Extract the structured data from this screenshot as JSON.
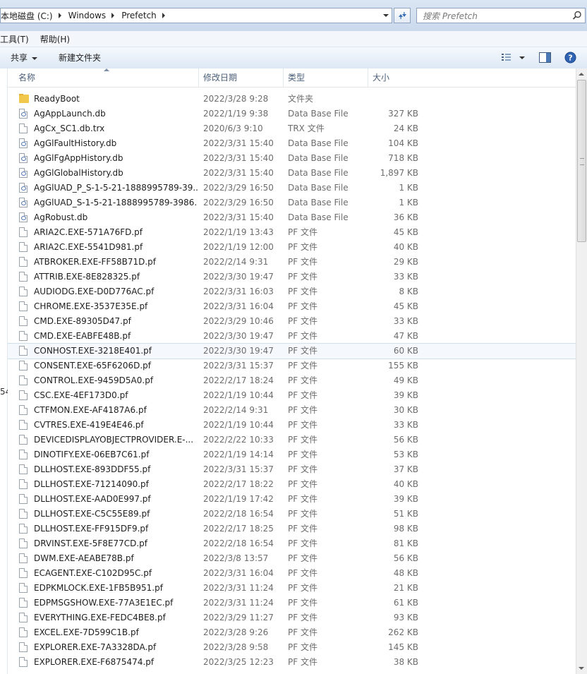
{
  "address": {
    "crumbs": [
      "本地磁盘 (C:)",
      "Windows",
      "Prefetch"
    ]
  },
  "search": {
    "placeholder": "搜索 Prefetch"
  },
  "menu": {
    "items": [
      "工具(T)",
      "帮助(H)"
    ]
  },
  "toolbar": {
    "share_label": "共享",
    "new_folder_label": "新建文件夹"
  },
  "columns": {
    "name": "名称",
    "date": "修改日期",
    "type": "类型",
    "size": "大小"
  },
  "selected_row": 17,
  "stray_glyph": "54",
  "files": [
    {
      "icon": "folder",
      "name": "ReadyBoot",
      "date": "2022/3/28 9:28",
      "type": "文件夹",
      "size": ""
    },
    {
      "icon": "db",
      "name": "AgAppLaunch.db",
      "date": "2022/1/19 9:38",
      "type": "Data Base File",
      "size": "327 KB"
    },
    {
      "icon": "file",
      "name": "AgCx_SC1.db.trx",
      "date": "2020/6/3 9:10",
      "type": "TRX 文件",
      "size": "24 KB"
    },
    {
      "icon": "db",
      "name": "AgGlFaultHistory.db",
      "date": "2022/3/31 15:40",
      "type": "Data Base File",
      "size": "104 KB"
    },
    {
      "icon": "db",
      "name": "AgGlFgAppHistory.db",
      "date": "2022/3/31 15:40",
      "type": "Data Base File",
      "size": "718 KB"
    },
    {
      "icon": "db",
      "name": "AgGlGlobalHistory.db",
      "date": "2022/3/31 15:40",
      "type": "Data Base File",
      "size": "1,897 KB"
    },
    {
      "icon": "db",
      "name": "AgGlUAD_P_S-1-5-21-1888995789-39...",
      "date": "2022/3/29 16:50",
      "type": "Data Base File",
      "size": "1 KB"
    },
    {
      "icon": "db",
      "name": "AgGlUAD_S-1-5-21-1888995789-3986...",
      "date": "2022/3/29 16:50",
      "type": "Data Base File",
      "size": "1 KB"
    },
    {
      "icon": "db",
      "name": "AgRobust.db",
      "date": "2022/3/31 15:40",
      "type": "Data Base File",
      "size": "36 KB"
    },
    {
      "icon": "file",
      "name": "ARIA2C.EXE-571A76FD.pf",
      "date": "2022/1/19 13:43",
      "type": "PF 文件",
      "size": "45 KB"
    },
    {
      "icon": "file",
      "name": "ARIA2C.EXE-5541D981.pf",
      "date": "2022/1/19 12:00",
      "type": "PF 文件",
      "size": "40 KB"
    },
    {
      "icon": "file",
      "name": "ATBROKER.EXE-FF58B71D.pf",
      "date": "2022/2/14 9:31",
      "type": "PF 文件",
      "size": "29 KB"
    },
    {
      "icon": "file",
      "name": "ATTRIB.EXE-8E828325.pf",
      "date": "2022/3/30 19:47",
      "type": "PF 文件",
      "size": "33 KB"
    },
    {
      "icon": "file",
      "name": "AUDIODG.EXE-D0D776AC.pf",
      "date": "2022/3/31 16:03",
      "type": "PF 文件",
      "size": "8 KB"
    },
    {
      "icon": "file",
      "name": "CHROME.EXE-3537E35E.pf",
      "date": "2022/3/31 16:04",
      "type": "PF 文件",
      "size": "45 KB"
    },
    {
      "icon": "file",
      "name": "CMD.EXE-89305D47.pf",
      "date": "2022/3/29 10:46",
      "type": "PF 文件",
      "size": "33 KB"
    },
    {
      "icon": "file",
      "name": "CMD.EXE-EABFE48B.pf",
      "date": "2022/3/30 19:47",
      "type": "PF 文件",
      "size": "47 KB"
    },
    {
      "icon": "file",
      "name": "CONHOST.EXE-3218E401.pf",
      "date": "2022/3/30 19:47",
      "type": "PF 文件",
      "size": "60 KB"
    },
    {
      "icon": "file",
      "name": "CONSENT.EXE-65F6206D.pf",
      "date": "2022/3/31 15:37",
      "type": "PF 文件",
      "size": "155 KB"
    },
    {
      "icon": "file",
      "name": "CONTROL.EXE-9459D5A0.pf",
      "date": "2022/2/17 18:24",
      "type": "PF 文件",
      "size": "49 KB"
    },
    {
      "icon": "file",
      "name": "CSC.EXE-4EF173D0.pf",
      "date": "2022/1/19 10:44",
      "type": "PF 文件",
      "size": "39 KB"
    },
    {
      "icon": "file",
      "name": "CTFMON.EXE-AF4187A6.pf",
      "date": "2022/2/14 9:31",
      "type": "PF 文件",
      "size": "30 KB"
    },
    {
      "icon": "file",
      "name": "CVTRES.EXE-419E4E46.pf",
      "date": "2022/1/19 10:44",
      "type": "PF 文件",
      "size": "33 KB"
    },
    {
      "icon": "file",
      "name": "DEVICEDISPLAYOBJECTPROVIDER.E-...",
      "date": "2022/2/22 10:33",
      "type": "PF 文件",
      "size": "56 KB"
    },
    {
      "icon": "file",
      "name": "DINOTIFY.EXE-06EB7C61.pf",
      "date": "2022/1/19 14:14",
      "type": "PF 文件",
      "size": "53 KB"
    },
    {
      "icon": "file",
      "name": "DLLHOST.EXE-893DDF55.pf",
      "date": "2022/3/31 15:37",
      "type": "PF 文件",
      "size": "37 KB"
    },
    {
      "icon": "file",
      "name": "DLLHOST.EXE-71214090.pf",
      "date": "2022/2/17 18:22",
      "type": "PF 文件",
      "size": "40 KB"
    },
    {
      "icon": "file",
      "name": "DLLHOST.EXE-AAD0E997.pf",
      "date": "2022/1/19 17:42",
      "type": "PF 文件",
      "size": "39 KB"
    },
    {
      "icon": "file",
      "name": "DLLHOST.EXE-C5C55E89.pf",
      "date": "2022/2/18 16:54",
      "type": "PF 文件",
      "size": "51 KB"
    },
    {
      "icon": "file",
      "name": "DLLHOST.EXE-FF915DF9.pf",
      "date": "2022/2/17 18:25",
      "type": "PF 文件",
      "size": "98 KB"
    },
    {
      "icon": "file",
      "name": "DRVINST.EXE-5F8E77CD.pf",
      "date": "2022/2/18 16:54",
      "type": "PF 文件",
      "size": "81 KB"
    },
    {
      "icon": "file",
      "name": "DWM.EXE-AEABE78B.pf",
      "date": "2022/3/8 13:57",
      "type": "PF 文件",
      "size": "56 KB"
    },
    {
      "icon": "file",
      "name": "ECAGENT.EXE-C102D95C.pf",
      "date": "2022/3/31 16:04",
      "type": "PF 文件",
      "size": "48 KB"
    },
    {
      "icon": "file",
      "name": "EDPKMLOCK.EXE-1FB5B951.pf",
      "date": "2022/3/31 11:24",
      "type": "PF 文件",
      "size": "21 KB"
    },
    {
      "icon": "file",
      "name": "EDPMSGSHOW.EXE-77A3E1EC.pf",
      "date": "2022/3/31 11:24",
      "type": "PF 文件",
      "size": "61 KB"
    },
    {
      "icon": "file",
      "name": "EVERYTHING.EXE-FEDC4BE8.pf",
      "date": "2022/3/29 11:27",
      "type": "PF 文件",
      "size": "93 KB"
    },
    {
      "icon": "file",
      "name": "EXCEL.EXE-7D599C1B.pf",
      "date": "2022/3/28 9:26",
      "type": "PF 文件",
      "size": "262 KB"
    },
    {
      "icon": "file",
      "name": "EXPLORER.EXE-7A3328DA.pf",
      "date": "2022/3/28 9:58",
      "type": "PF 文件",
      "size": "145 KB"
    },
    {
      "icon": "file",
      "name": "EXPLORER.EXE-F6875474.pf",
      "date": "2022/3/25 12:23",
      "type": "PF 文件",
      "size": "38 KB"
    }
  ]
}
